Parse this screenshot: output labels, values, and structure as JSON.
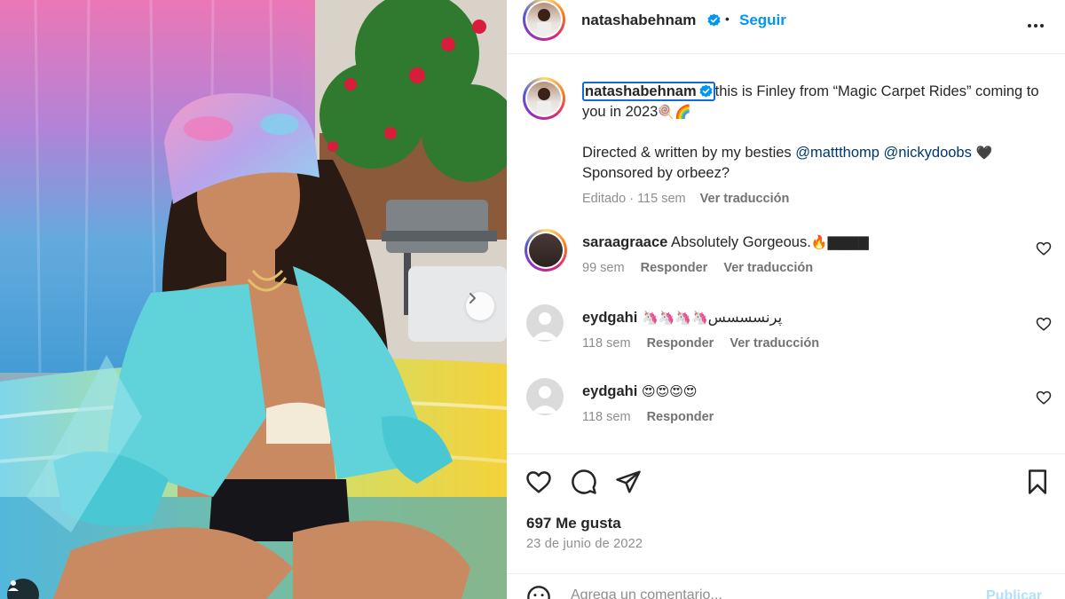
{
  "post": {
    "author": "natashabehnam",
    "follow_label": "Seguir",
    "separator": "•"
  },
  "caption": {
    "username": "natashabehnam",
    "line1": "this is Finley from “Magic Carpet Rides” coming to you in 2023",
    "line1_emoji": "🍭🌈",
    "line2_start": "Directed & written by my besties ",
    "mention1": "@mattthomp",
    "mention2": "@nickydoobs",
    "line2_emoji": "🖤",
    "line3": "Sponsored by orbeez?",
    "edited": "Editado · 115 sem",
    "translate": "Ver traducción"
  },
  "comments": [
    {
      "username": "saraagraace",
      "text": "Absolutely Gorgeous.",
      "emoji": "🔥▇▇▇▇",
      "time": "99 sem",
      "reply": "Responder",
      "translate": "Ver traducción"
    },
    {
      "username": "eydgahi",
      "text": "پرنسسسس",
      "emoji": "🦄🦄🦄🦄",
      "time": "118 sem",
      "reply": "Responder",
      "translate": "Ver traducción"
    },
    {
      "username": "eydgahi",
      "text": "",
      "emoji": "😍😍😍😍",
      "time": "118 sem",
      "reply": "Responder",
      "translate": ""
    }
  ],
  "stats": {
    "likes": "697 Me gusta",
    "date": "23 de junio de 2022"
  },
  "composer": {
    "placeholder": "Agrega un comentario...",
    "publish": "Publicar"
  },
  "colors": {
    "accent": "#0095f6",
    "verified": "#0095f6",
    "mention": "#00376b",
    "muted": "#8e8e8e",
    "highlight_box": "#0f6bd8"
  },
  "icons": [
    "more-icon",
    "verified-icon",
    "like-icon",
    "comment-icon",
    "share-icon",
    "save-icon",
    "emoji-icon",
    "chevron-right-icon",
    "user-tag-icon"
  ]
}
